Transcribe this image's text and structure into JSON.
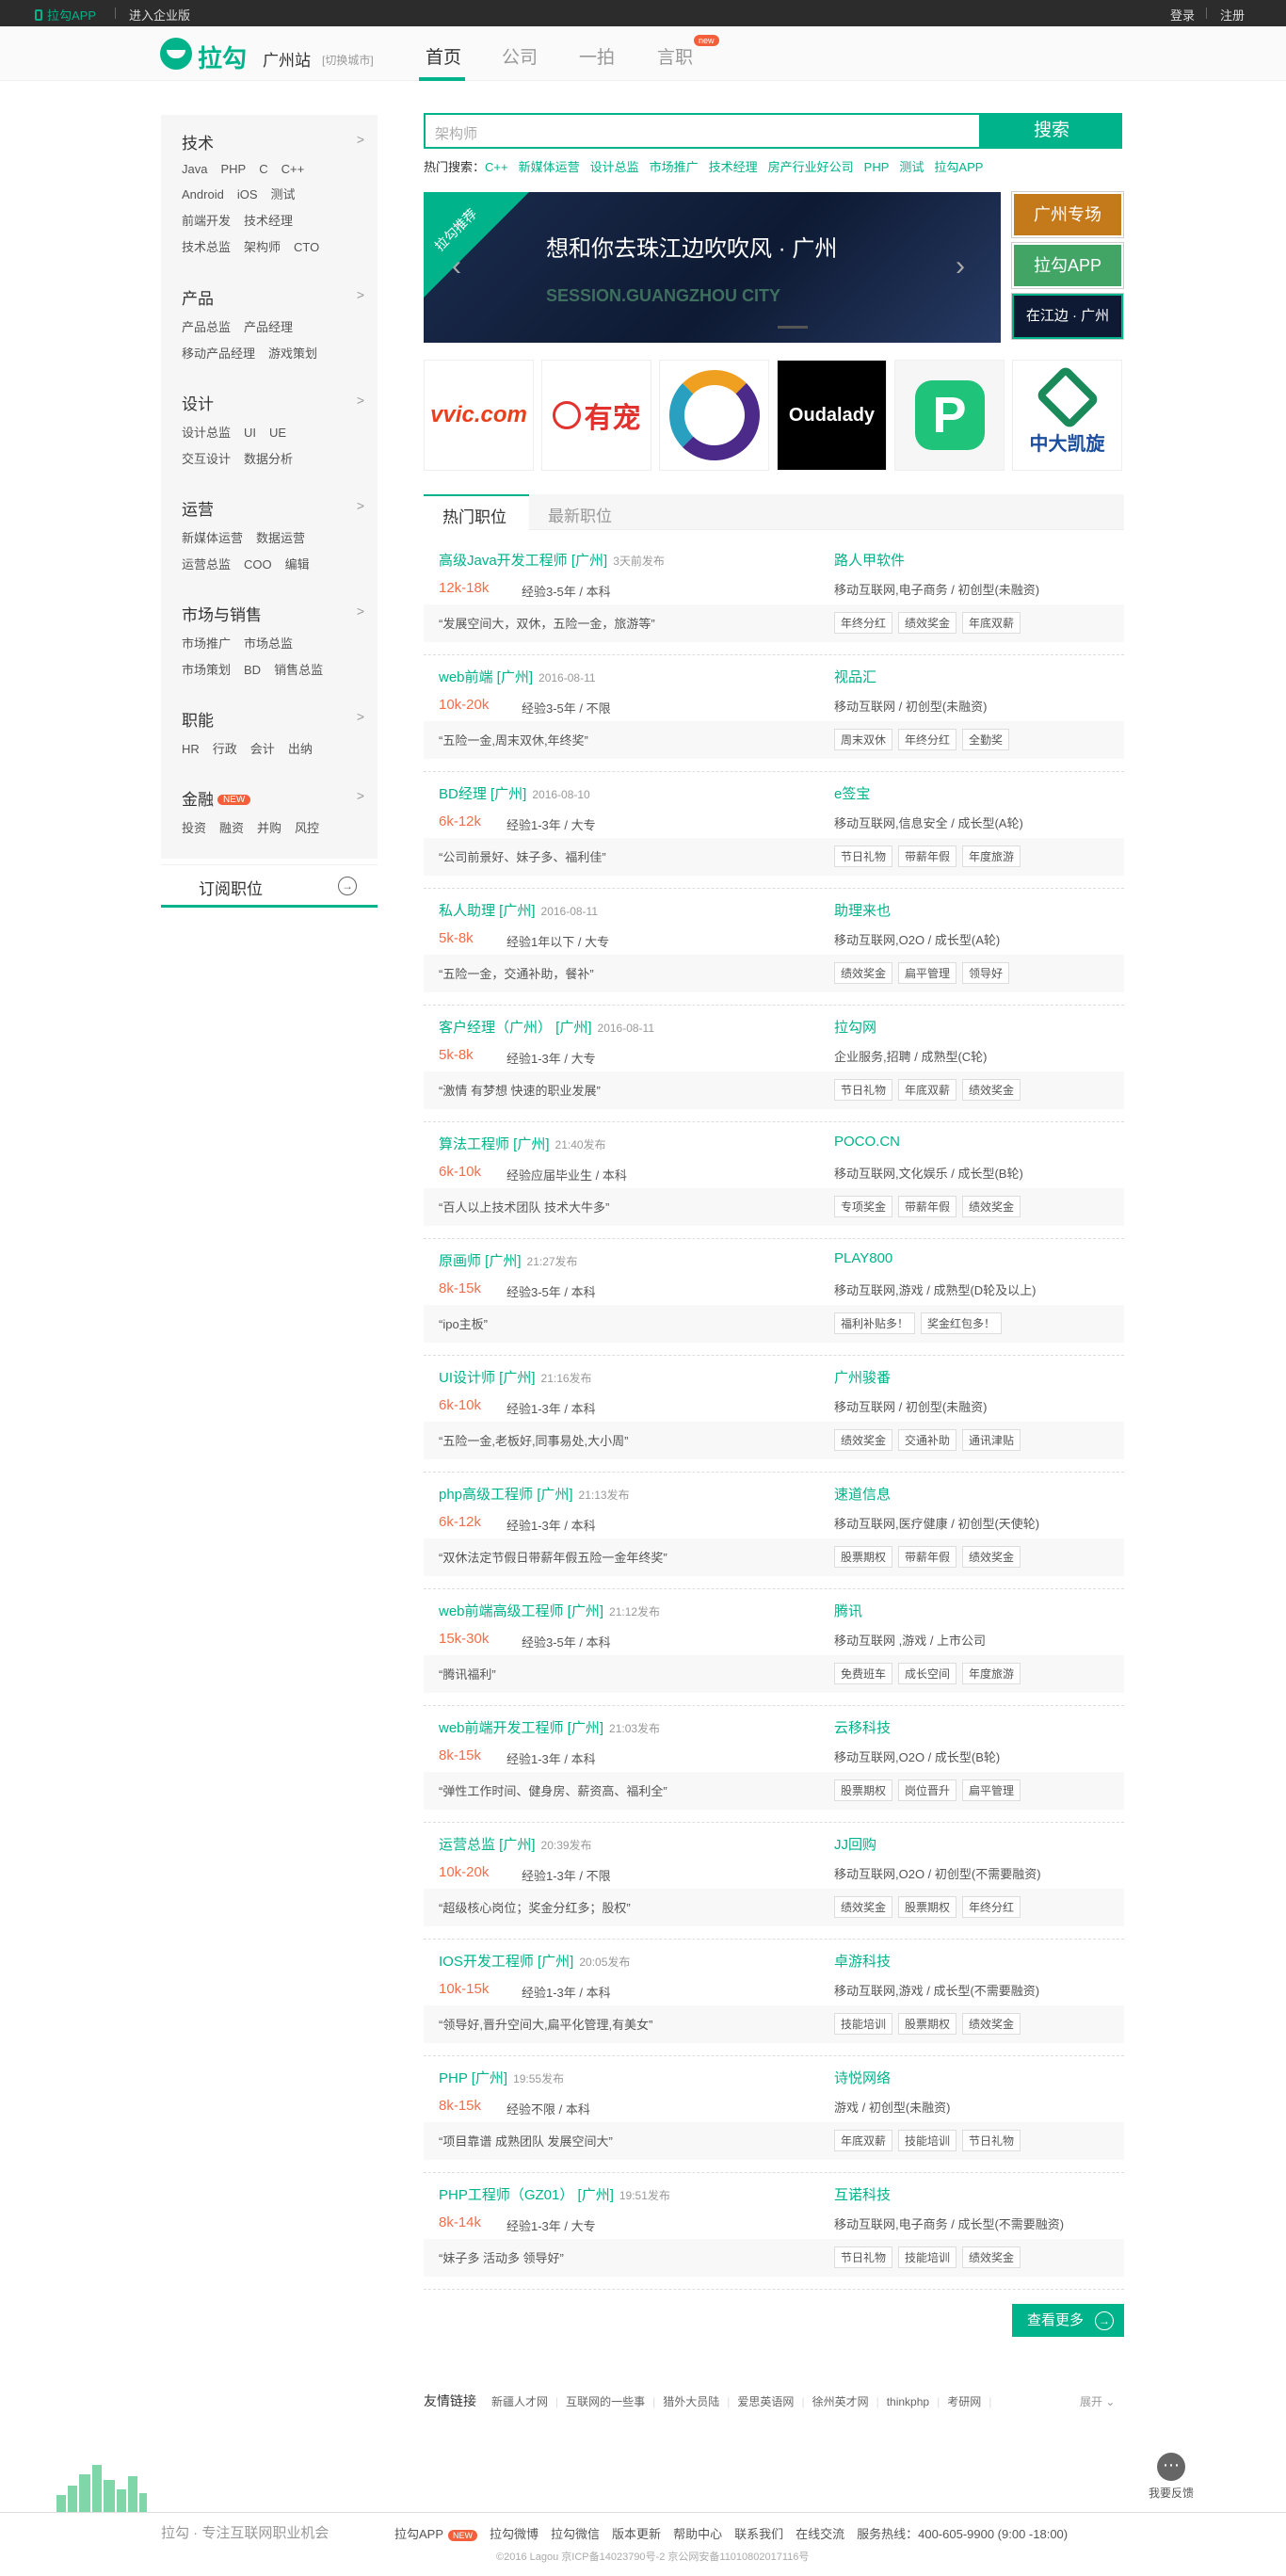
{
  "topbar": {
    "app": "拉勾APP",
    "enterprise": "进入企业版",
    "login": "登录",
    "register": "注册"
  },
  "header": {
    "logo": "拉勾",
    "city": "广州站",
    "switch_city": "[切换城市]",
    "nav": [
      "首页",
      "公司",
      "一拍",
      "言职"
    ],
    "new_badge": "new"
  },
  "sidebar": {
    "categories": [
      {
        "title": "技术",
        "rows": [
          [
            "Java",
            "PHP",
            "C",
            "C++"
          ],
          [
            "Android",
            "iOS",
            "测试"
          ],
          [
            "前端开发",
            "技术经理"
          ],
          [
            "技术总监",
            "架构师",
            "CTO"
          ]
        ]
      },
      {
        "title": "产品",
        "rows": [
          [
            "产品总监",
            "产品经理"
          ],
          [
            "移动产品经理",
            "游戏策划"
          ]
        ]
      },
      {
        "title": "设计",
        "rows": [
          [
            "设计总监",
            "UI",
            "UE"
          ],
          [
            "交互设计",
            "数据分析"
          ]
        ]
      },
      {
        "title": "运营",
        "rows": [
          [
            "新媒体运营",
            "数据运营"
          ],
          [
            "运营总监",
            "COO",
            "编辑"
          ]
        ]
      },
      {
        "title": "市场与销售",
        "rows": [
          [
            "市场推广",
            "市场总监"
          ],
          [
            "市场策划",
            "BD",
            "销售总监"
          ]
        ]
      },
      {
        "title": "职能",
        "rows": [
          [
            "HR",
            "行政",
            "会计",
            "出纳"
          ]
        ]
      },
      {
        "title": "金融",
        "badge": "NEW",
        "rows": [
          [
            "投资",
            "融资",
            "并购",
            "风控"
          ]
        ]
      }
    ],
    "subscribe": "订阅职位"
  },
  "search": {
    "placeholder": "架构师",
    "button": "搜索"
  },
  "hot": {
    "label": "热门搜索：",
    "items": [
      "C++",
      "新媒体运营",
      "设计总监",
      "市场推广",
      "技术经理",
      "房产行业好公司",
      "PHP",
      "测试",
      "拉勾APP"
    ]
  },
  "banner": {
    "corner": "拉勾推荐",
    "title": "想和你去珠江边吹吹风 · 广州",
    "subtitle": "SESSION.GUANGZHOU CITY"
  },
  "side_tabs": [
    "广州专场",
    "拉勾APP",
    "在江边 · 广州"
  ],
  "logos": [
    "vvic.com",
    "有宠",
    "",
    "Oudalady",
    "P",
    "中大凯旋"
  ],
  "tabs": [
    "热门职位",
    "最新职位"
  ],
  "jobs": [
    {
      "title": "高级Java开发工程师 [广州]",
      "date": "3天前发布",
      "salary": "12k-18k",
      "exp": "经验3-5年 / 本科",
      "quote": "“发展空间大，双休，五险一金，旅游等”",
      "company": "路人甲软件",
      "industry": "移动互联网,电子商务 / 初创型(未融资)",
      "tags": [
        "年终分红",
        "绩效奖金",
        "年底双薪"
      ]
    },
    {
      "title": "web前端 [广州]",
      "date": "2016-08-11",
      "salary": "10k-20k",
      "exp": "经验3-5年 / 不限",
      "quote": "“五险一金,周末双休,年终奖”",
      "company": "视品汇",
      "industry": "移动互联网 / 初创型(未融资)",
      "tags": [
        "周末双休",
        "年终分红",
        "全勤奖"
      ]
    },
    {
      "title": "BD经理 [广州]",
      "date": "2016-08-10",
      "salary": "6k-12k",
      "exp": "经验1-3年 / 大专",
      "quote": "“公司前景好、妹子多、福利佳”",
      "company": "e签宝",
      "industry": "移动互联网,信息安全 / 成长型(A轮)",
      "tags": [
        "节日礼物",
        "带薪年假",
        "年度旅游"
      ]
    },
    {
      "title": "私人助理 [广州]",
      "date": "2016-08-11",
      "salary": "5k-8k",
      "exp": "经验1年以下 / 大专",
      "quote": "“五险一金，交通补助，餐补”",
      "company": "助理来也",
      "industry": "移动互联网,O2O / 成长型(A轮)",
      "tags": [
        "绩效奖金",
        "扁平管理",
        "领导好"
      ]
    },
    {
      "title": "客户经理（广州） [广州]",
      "date": "2016-08-11",
      "salary": "5k-8k",
      "exp": "经验1-3年 / 大专",
      "quote": "“激情 有梦想 快速的职业发展”",
      "company": "拉勾网",
      "industry": "企业服务,招聘 / 成熟型(C轮)",
      "tags": [
        "节日礼物",
        "年底双薪",
        "绩效奖金"
      ]
    },
    {
      "title": "算法工程师 [广州]",
      "date": "21:40发布",
      "salary": "6k-10k",
      "exp": "经验应届毕业生 / 本科",
      "quote": "“百人以上技术团队 技术大牛多”",
      "company": "POCO.CN",
      "industry": "移动互联网,文化娱乐 / 成长型(B轮)",
      "tags": [
        "专项奖金",
        "带薪年假",
        "绩效奖金"
      ]
    },
    {
      "title": "原画师 [广州]",
      "date": "21:27发布",
      "salary": "8k-15k",
      "exp": "经验3-5年 / 本科",
      "quote": "“ipo主板”",
      "company": "PLAY800",
      "industry": "移动互联网,游戏 / 成熟型(D轮及以上)",
      "tags": [
        "福利补贴多！",
        "奖金红包多！"
      ]
    },
    {
      "title": "UI设计师 [广州]",
      "date": "21:16发布",
      "salary": "6k-10k",
      "exp": "经验1-3年 / 本科",
      "quote": "“五险一金,老板好,同事易处,大小周”",
      "company": "广州骏番",
      "industry": "移动互联网 / 初创型(未融资)",
      "tags": [
        "绩效奖金",
        "交通补助",
        "通讯津贴"
      ]
    },
    {
      "title": "php高级工程师 [广州]",
      "date": "21:13发布",
      "salary": "6k-12k",
      "exp": "经验1-3年 / 本科",
      "quote": "“双休法定节假日带薪年假五险一金年终奖”",
      "company": "速道信息",
      "industry": "移动互联网,医疗健康 / 初创型(天使轮)",
      "tags": [
        "股票期权",
        "带薪年假",
        "绩效奖金"
      ]
    },
    {
      "title": "web前端高级工程师 [广州]",
      "date": "21:12发布",
      "salary": "15k-30k",
      "exp": "经验3-5年 / 本科",
      "quote": "“腾讯福利”",
      "company": "腾讯",
      "industry": "移动互联网 ,游戏 / 上市公司",
      "tags": [
        "免费班车",
        "成长空间",
        "年度旅游"
      ]
    },
    {
      "title": "web前端开发工程师 [广州]",
      "date": "21:03发布",
      "salary": "8k-15k",
      "exp": "经验1-3年 / 本科",
      "quote": "“弹性工作时间、健身房、薪资高、福利全”",
      "company": "云移科技",
      "industry": "移动互联网,O2O / 成长型(B轮)",
      "tags": [
        "股票期权",
        "岗位晋升",
        "扁平管理"
      ]
    },
    {
      "title": "运营总监 [广州]",
      "date": "20:39发布",
      "salary": "10k-20k",
      "exp": "经验1-3年 / 不限",
      "quote": "“超级核心岗位；奖金分红多；股权”",
      "company": "JJ回购",
      "industry": "移动互联网,O2O / 初创型(不需要融资)",
      "tags": [
        "绩效奖金",
        "股票期权",
        "年终分红"
      ]
    },
    {
      "title": "IOS开发工程师 [广州]",
      "date": "20:05发布",
      "salary": "10k-15k",
      "exp": "经验1-3年 / 本科",
      "quote": "“领导好,晋升空间大,扁平化管理,有美女”",
      "company": "卓游科技",
      "industry": "移动互联网,游戏 / 成长型(不需要融资)",
      "tags": [
        "技能培训",
        "股票期权",
        "绩效奖金"
      ]
    },
    {
      "title": "PHP [广州]",
      "date": "19:55发布",
      "salary": "8k-15k",
      "exp": "经验不限 / 本科",
      "quote": "“项目靠谱 成熟团队 发展空间大”",
      "company": "诗悦网络",
      "industry": "游戏 / 初创型(未融资)",
      "tags": [
        "年底双薪",
        "技能培训",
        "节日礼物"
      ]
    },
    {
      "title": "PHP工程师（GZ01） [广州]",
      "date": "19:51发布",
      "salary": "8k-14k",
      "exp": "经验1-3年 / 大专",
      "quote": "“妹子多 活动多 领导好”",
      "company": "互诺科技",
      "industry": "移动互联网,电子商务 / 成长型(不需要融资)",
      "tags": [
        "节日礼物",
        "技能培训",
        "绩效奖金"
      ]
    }
  ],
  "more": "查看更多",
  "friend_links": {
    "label": "友情链接",
    "items": [
      "新疆人才网",
      "互联网的一些事",
      "猎外大员陆",
      "爱思英语网",
      "徐州英才网",
      "thinkphp",
      "考研网"
    ],
    "expand": "展开"
  },
  "feedback": "我要反馈",
  "footer": {
    "logo": "拉勾 · 专注互联网职业机会",
    "links": [
      "拉勾APP",
      "拉勾微博",
      "拉勾微信",
      "版本更新",
      "帮助中心",
      "联系我们",
      "在线交流",
      "服务热线：400-605-9900 (9:00 -18:00)"
    ],
    "new": "NEW",
    "copyright": "©2016 Lagou 京ICP备14023790号-2 京公网安备11010802017116号"
  },
  "colors": {
    "brand": "#00b38a",
    "salary": "#f26d49",
    "badge": "#f25f3a"
  }
}
